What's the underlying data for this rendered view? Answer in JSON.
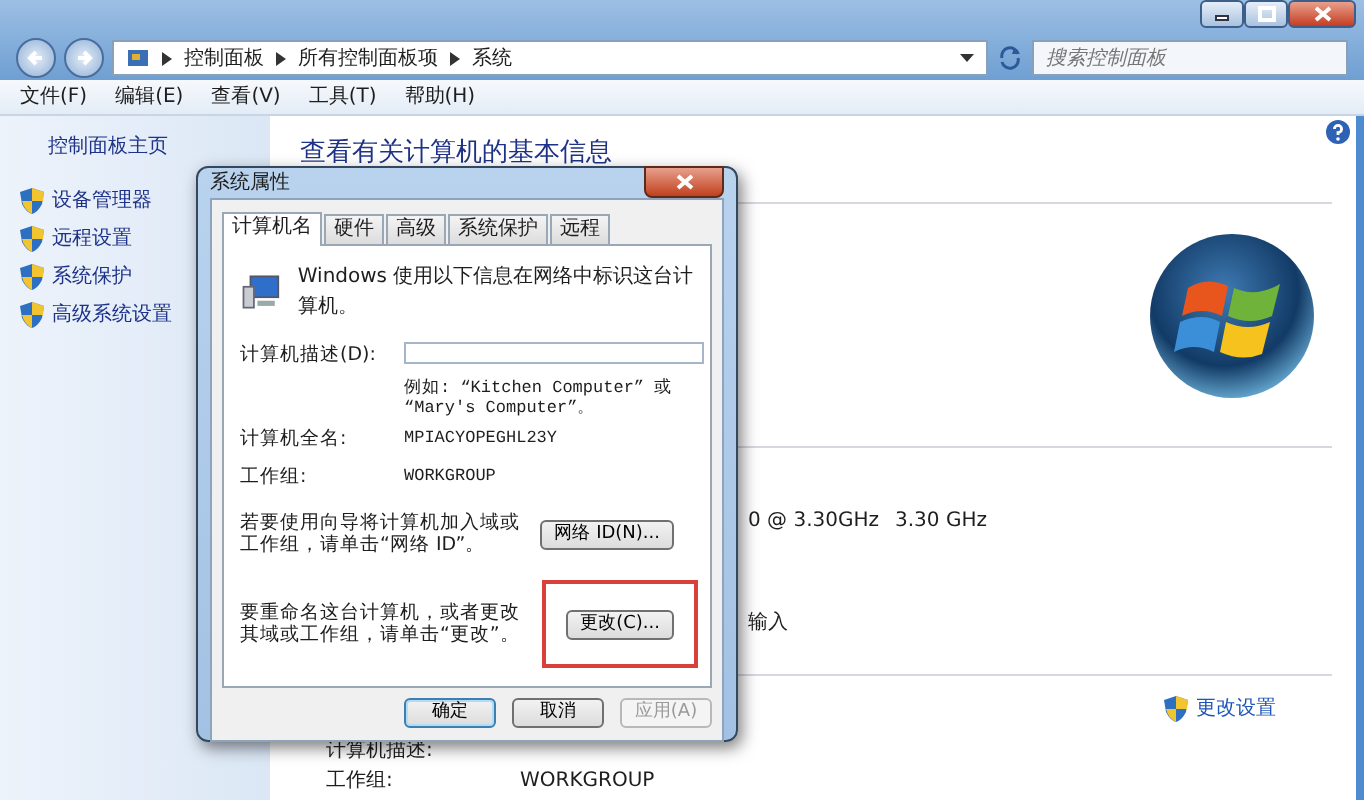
{
  "window": {
    "breadcrumb": [
      "控制面板",
      "所有控制面板项",
      "系统"
    ],
    "search": {
      "placeholder": "搜索控制面板"
    },
    "menu": [
      "文件(F)",
      "编辑(E)",
      "查看(V)",
      "工具(T)",
      "帮助(H)"
    ]
  },
  "sidebar": {
    "home": "控制面板主页",
    "items": [
      "设备管理器",
      "远程设置",
      "系统保护",
      "高级系统设置"
    ]
  },
  "main": {
    "title": "查看有关计算机的基本信息",
    "processor": "0 @ 3.30GHz",
    "speed": "3.30 GHz",
    "input_fragment": "输入",
    "change_settings_link": "更改设置",
    "details": [
      {
        "label": "计算机描述:"
      },
      {
        "label": "工作组:",
        "value": "WORKGROUP"
      }
    ]
  },
  "dialog": {
    "title": "系统属性",
    "tabs": [
      {
        "label": "计算机名",
        "selected": true
      },
      {
        "label": "硬件",
        "selected": false
      },
      {
        "label": "高级",
        "selected": false
      },
      {
        "label": "系统保护",
        "selected": false
      },
      {
        "label": "远程",
        "selected": false
      }
    ],
    "intro": "Windows 使用以下信息在网络中标识这台计算机。",
    "description_label": "计算机描述(D):",
    "hint": "例如: “Kitchen Computer” 或 “Mary's Computer”。",
    "fields": [
      {
        "label": "计算机全名:",
        "value": "MPIACYOPEGHL23Y"
      },
      {
        "label": "工作组:",
        "value": "WORKGROUP"
      }
    ],
    "actions": [
      {
        "text": "若要使用向导将计算机加入域或工作组，请单击“网络 ID”。",
        "button": "网络 ID(N)...",
        "highlighted": false
      },
      {
        "text": "要重命名这台计算机，或者更改其域或工作组，请单击“更改”。",
        "button": "更改(C)...",
        "highlighted": true
      }
    ],
    "buttons": [
      {
        "label": "确定",
        "default": true,
        "disabled": false
      },
      {
        "label": "取消",
        "default": false,
        "disabled": false
      },
      {
        "label": "应用(A)",
        "default": false,
        "disabled": true
      }
    ]
  }
}
